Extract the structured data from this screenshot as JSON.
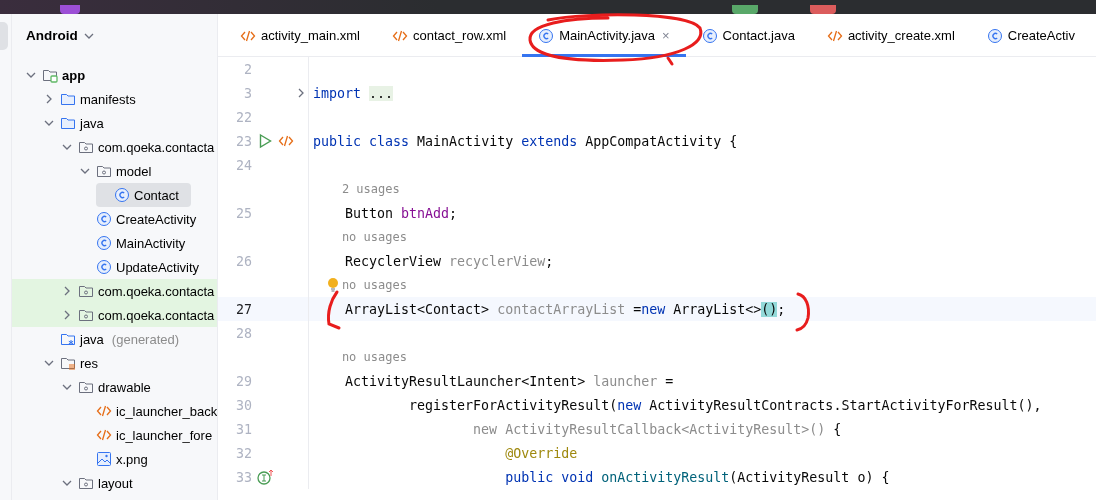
{
  "project_panel": {
    "title": "Android",
    "tree": [
      {
        "label": "app",
        "kind": "module",
        "bold": true,
        "expanded": true,
        "selected": false,
        "highlighted": false,
        "children": [
          {
            "label": "manifests",
            "kind": "folder",
            "bold": false,
            "expanded": false,
            "selected": false,
            "highlighted": false
          },
          {
            "label": "java",
            "kind": "folder",
            "bold": false,
            "expanded": true,
            "selected": false,
            "highlighted": false,
            "children": [
              {
                "label": "com.qoeka.contacta",
                "kind": "package",
                "bold": false,
                "expanded": true,
                "selected": false,
                "highlighted": false,
                "children": [
                  {
                    "label": "model",
                    "kind": "package",
                    "bold": false,
                    "expanded": true,
                    "selected": false,
                    "highlighted": false,
                    "children": [
                      {
                        "label": "Contact",
                        "kind": "class",
                        "bold": false,
                        "selected": true,
                        "highlighted": false
                      }
                    ]
                  },
                  {
                    "label": "CreateActivity",
                    "kind": "class",
                    "bold": false,
                    "selected": false,
                    "highlighted": false
                  },
                  {
                    "label": "MainActivity",
                    "kind": "class",
                    "bold": false,
                    "selected": false,
                    "highlighted": false
                  },
                  {
                    "label": "UpdateActivity",
                    "kind": "class",
                    "bold": false,
                    "selected": false,
                    "highlighted": false
                  }
                ]
              },
              {
                "label": "com.qoeka.contacta",
                "kind": "package",
                "bold": false,
                "expanded": false,
                "selected": false,
                "highlighted": true
              },
              {
                "label": "com.qoeka.contacta",
                "kind": "package",
                "bold": false,
                "expanded": false,
                "selected": false,
                "highlighted": true
              }
            ]
          },
          {
            "label": "java",
            "suffix": "(generated)",
            "kind": "generated",
            "bold": false,
            "selected": false,
            "highlighted": false
          },
          {
            "label": "res",
            "kind": "resources",
            "bold": false,
            "expanded": true,
            "selected": false,
            "highlighted": false,
            "children": [
              {
                "label": "drawable",
                "kind": "package",
                "bold": false,
                "expanded": true,
                "selected": false,
                "highlighted": false,
                "children": [
                  {
                    "label": "ic_launcher_back",
                    "kind": "xml",
                    "bold": false,
                    "selected": false,
                    "highlighted": false
                  },
                  {
                    "label": "ic_launcher_fore",
                    "kind": "xml",
                    "bold": false,
                    "selected": false,
                    "highlighted": false
                  },
                  {
                    "label": "x.png",
                    "kind": "image",
                    "bold": false,
                    "selected": false,
                    "highlighted": false
                  }
                ]
              },
              {
                "label": "layout",
                "kind": "package",
                "bold": false,
                "expanded": true,
                "selected": false,
                "highlighted": false
              }
            ]
          }
        ]
      }
    ]
  },
  "editor_tabs": [
    {
      "label": "activity_main.xml",
      "kind": "xml",
      "selected": false
    },
    {
      "label": "contact_row.xml",
      "kind": "xml",
      "selected": false
    },
    {
      "label": "MainActivity.java",
      "kind": "class",
      "selected": true,
      "close": "×"
    },
    {
      "label": "Contact.java",
      "kind": "class",
      "selected": false
    },
    {
      "label": "activity_create.xml",
      "kind": "xml",
      "selected": false
    },
    {
      "label": "CreateActiv",
      "kind": "class",
      "selected": false
    }
  ],
  "code_lines": [
    {
      "kind": "blank",
      "number": "2",
      "current": false
    },
    {
      "kind": "folded",
      "number": "3",
      "current": false,
      "tokens": [
        {
          "text": "import",
          "kind": "keyword"
        },
        {
          "text": "...",
          "kind": "folded"
        }
      ]
    },
    {
      "kind": "blank",
      "number": "22",
      "current": false
    },
    {
      "kind": "run",
      "number": "23",
      "current": false,
      "tokens": [
        {
          "text": "public class",
          "kind": "keyword"
        },
        {
          "text": " MainActivity ",
          "kind": "plain"
        },
        {
          "text": "extends",
          "kind": "keyword"
        },
        {
          "text": " AppCompatActivity {",
          "kind": "plain"
        }
      ]
    },
    {
      "kind": "blank",
      "number": "24",
      "current": false
    },
    {
      "kind": "hint",
      "text": "    2 usages",
      "bulb": false
    },
    {
      "kind": "code",
      "number": "25",
      "current": false,
      "tokens": [
        {
          "text": "    Button ",
          "kind": "plain"
        },
        {
          "text": "btnAdd",
          "kind": "field"
        },
        {
          "text": ";",
          "kind": "plain"
        }
      ]
    },
    {
      "kind": "hint",
      "text": "    no usages",
      "bulb": false
    },
    {
      "kind": "code",
      "number": "26",
      "current": false,
      "tokens": [
        {
          "text": "    RecyclerView ",
          "kind": "plain"
        },
        {
          "text": "recyclerView",
          "kind": "unused"
        },
        {
          "text": ";",
          "kind": "plain"
        }
      ]
    },
    {
      "kind": "hint",
      "text": "    no usages",
      "bulb": true
    },
    {
      "kind": "code",
      "number": "27",
      "current": true,
      "tokens": [
        {
          "text": "    ArrayList<Contact> ",
          "kind": "plain"
        },
        {
          "text": "contactArrayList",
          "kind": "unused"
        },
        {
          "text": " =",
          "kind": "plain"
        },
        {
          "text": "new",
          "kind": "keyword"
        },
        {
          "text": " ArrayList<>",
          "kind": "plain"
        },
        {
          "text": "()",
          "kind": "match"
        },
        {
          "text": ";",
          "kind": "plain"
        }
      ]
    },
    {
      "kind": "blank",
      "number": "28",
      "current": false
    },
    {
      "kind": "hint",
      "text": "    no usages",
      "bulb": false
    },
    {
      "kind": "code",
      "number": "29",
      "current": false,
      "tokens": [
        {
          "text": "    ActivityResultLauncher<Intent> ",
          "kind": "plain"
        },
        {
          "text": "launcher",
          "kind": "unused"
        },
        {
          "text": " =",
          "kind": "plain"
        }
      ]
    },
    {
      "kind": "code",
      "number": "30",
      "current": false,
      "tokens": [
        {
          "text": "            registerForActivityResult(",
          "kind": "plain"
        },
        {
          "text": "new",
          "kind": "keyword"
        },
        {
          "text": " ActivityResultContracts.StartActivityForResult(),",
          "kind": "plain"
        }
      ]
    },
    {
      "kind": "code",
      "number": "31",
      "current": false,
      "tokens": [
        {
          "text": "                    new ActivityResultCallback<ActivityResult>()",
          "kind": "unused"
        },
        {
          "text": " {",
          "kind": "plain"
        }
      ]
    },
    {
      "kind": "code",
      "number": "32",
      "current": false,
      "tokens": [
        {
          "text": "                        @Override",
          "kind": "annotation"
        }
      ]
    },
    {
      "kind": "implements",
      "number": "33",
      "current": false,
      "tokens": [
        {
          "text": "                        public void",
          "kind": "keyword"
        },
        {
          "text": " onActivityResult",
          "kind": "method"
        },
        {
          "text": "(ActivityResult o) {",
          "kind": "plain"
        }
      ]
    }
  ]
}
